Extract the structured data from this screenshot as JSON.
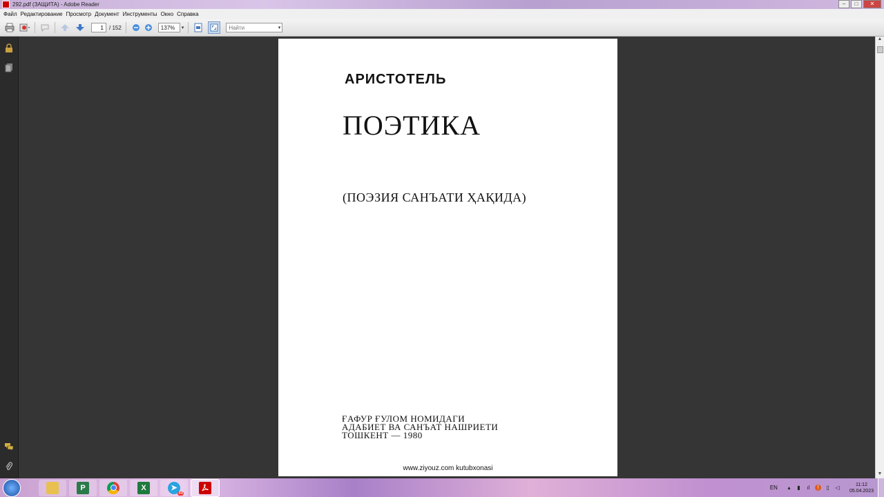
{
  "window": {
    "title": "292.pdf (ЗАЩИТА) - Adobe Reader",
    "minimize": "–",
    "maximize": "□",
    "close": "✕"
  },
  "menu": [
    "Файл",
    "Редактирование",
    "Просмотр",
    "Документ",
    "Инструменты",
    "Окно",
    "Справка"
  ],
  "toolbar": {
    "current_page": "1",
    "page_total": "/ 152",
    "zoom": "137%",
    "find_placeholder": "Найти"
  },
  "page": {
    "author": "АРИСТОТЕЛЬ",
    "title": "ПОЭТИКА",
    "subtitle": "(ПОЭЗИЯ САНЪАТИ ҲАҚИДА)",
    "publisher_line1": "ҒАФУР ҒУЛОМ НОМИДАГИ",
    "publisher_line2": "АДАБИЕТ ВА САНЪАТ НАШРИЕТИ",
    "publisher_line3": "ТОШКЕНТ — 1980",
    "footer": "www.ziyouz.com kutubxonasi"
  },
  "taskbar": {
    "items": [
      "explorer",
      "project",
      "chrome",
      "excel",
      "telegram",
      "adobe-reader"
    ],
    "telegram_badge": "44",
    "language": "EN",
    "time": "11:12",
    "date": "05.04.2023"
  }
}
